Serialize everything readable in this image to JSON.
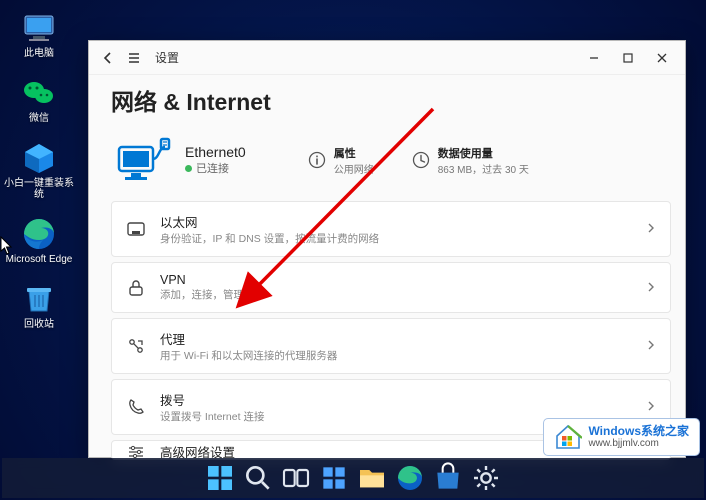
{
  "desktop_icons": [
    {
      "label": "此电脑"
    },
    {
      "label": "微信"
    },
    {
      "label": "小白一键重装系统"
    },
    {
      "label": "Microsoft Edge"
    },
    {
      "label": "回收站"
    }
  ],
  "window": {
    "title": "设置",
    "page_title": "网络 & Internet",
    "connection": {
      "name": "Ethernet0",
      "status": "已连接"
    },
    "properties": {
      "title": "属性",
      "sub": "公用网络"
    },
    "data_usage": {
      "title": "数据使用量",
      "sub": "863 MB，过去 30 天"
    },
    "items": [
      {
        "title": "以太网",
        "sub": "身份验证，IP 和 DNS 设置，按流量计费的网络"
      },
      {
        "title": "VPN",
        "sub": "添加，连接，管理"
      },
      {
        "title": "代理",
        "sub": "用于 Wi-Fi 和以太网连接的代理服务器"
      },
      {
        "title": "拨号",
        "sub": "设置拨号 Internet 连接"
      },
      {
        "title": "高级网络设置",
        "sub": ""
      }
    ]
  },
  "watermark": {
    "brand": "Windows系统之家",
    "url": "www.bjjmlv.com"
  }
}
